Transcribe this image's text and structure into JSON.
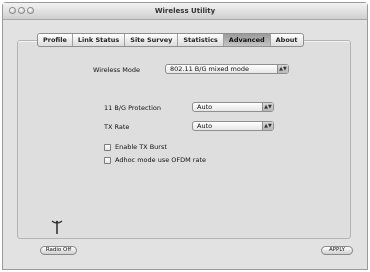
{
  "window": {
    "title": "Wireless Utility"
  },
  "tabs": [
    {
      "label": "Profile"
    },
    {
      "label": "Link Status"
    },
    {
      "label": "Site Survey"
    },
    {
      "label": "Statistics"
    },
    {
      "label": "Advanced",
      "active": true
    },
    {
      "label": "About"
    }
  ],
  "advanced": {
    "wireless_mode": {
      "label": "Wireless Mode",
      "value": "802.11 B/G mixed mode"
    },
    "bg_protection": {
      "label": "11 B/G Protection",
      "value": "Auto"
    },
    "tx_rate": {
      "label": "TX Rate",
      "value": "Auto"
    },
    "enable_tx_burst": {
      "label": "Enable TX Burst",
      "checked": false
    },
    "adhoc_ofdm": {
      "label": "Adhoc mode use OFDM rate",
      "checked": false
    }
  },
  "footer": {
    "radio_off_label": "Radio Off",
    "apply_label": "APPLY"
  },
  "icons": {
    "radio": "antenna-icon",
    "popup_arrows": "updown-arrows-icon"
  }
}
